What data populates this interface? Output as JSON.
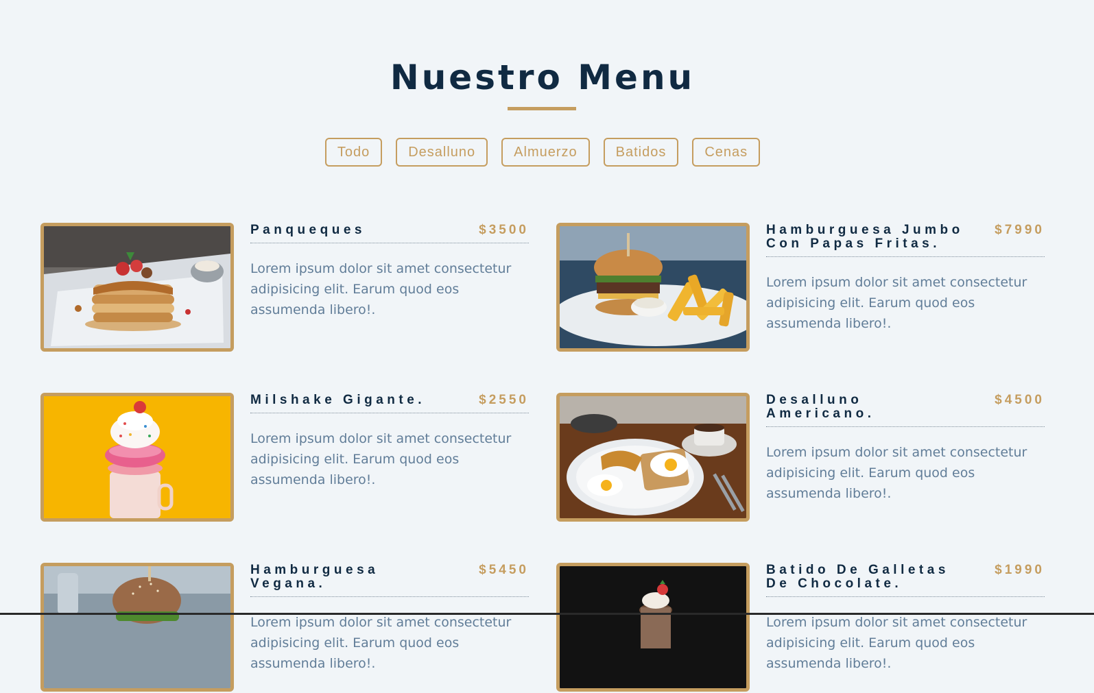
{
  "header": {
    "title": "Nuestro Menu"
  },
  "filters": [
    "Todo",
    "Desalluno",
    "Almuerzo",
    "Batidos",
    "Cenas"
  ],
  "items": [
    {
      "name": "Panqueques",
      "price": "$3500",
      "description": "Lorem ipsum dolor sit amet consectetur adipisicing elit. Earum quod eos assumenda libero!."
    },
    {
      "name": "Hamburguesa Jumbo Con Papas Fritas.",
      "price": "$7990",
      "description": "Lorem ipsum dolor sit amet consectetur adipisicing elit. Earum quod eos assumenda libero!."
    },
    {
      "name": "Milshake Gigante.",
      "price": "$2550",
      "description": "Lorem ipsum dolor sit amet consectetur adipisicing elit. Earum quod eos assumenda libero!."
    },
    {
      "name": "Desalluno Americano.",
      "price": "$4500",
      "description": "Lorem ipsum dolor sit amet consectetur adipisicing elit. Earum quod eos assumenda libero!."
    },
    {
      "name": "Hamburguesa Vegana.",
      "price": "$5450",
      "description": "Lorem ipsum dolor sit amet consectetur adipisicing elit. Earum quod eos assumenda libero!."
    },
    {
      "name": "Batido De Galletas De Chocolate.",
      "price": "$1990",
      "description": "Lorem ipsum dolor sit amet consectetur adipisicing elit. Earum quod eos assumenda libero!."
    }
  ],
  "colors": {
    "background": "#f1f5f8",
    "accent": "#c59d5f",
    "heading": "#102a42",
    "text": "#617d98"
  }
}
